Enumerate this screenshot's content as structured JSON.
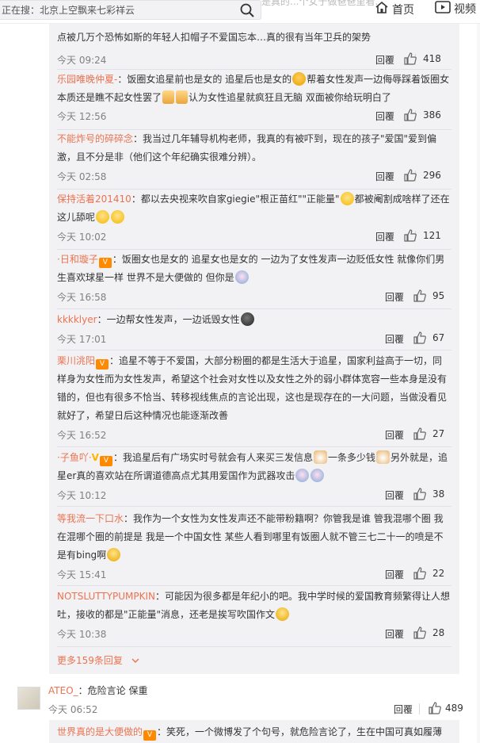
{
  "topbar": {
    "search_text": "正在搜：北京上空飘来七彩祥云",
    "ghost_text": "是真的...个女于做爸爸里看...",
    "home_label": "首页",
    "video_label": "视频"
  },
  "replies": [
    {
      "username": "",
      "text": "点被几万个恐怖如斯的年轻人扣帽子不爱国忘本…真的很有当年卫兵的架势",
      "time": "今天 09:24",
      "reply_label": "回覆",
      "likes": "418"
    },
    {
      "username": "乐园唯晚仲夏-",
      "text": "：饭圈女追星前也是女的 追星后也是女的",
      "text2": "帮着女性发声一边侮辱踩着饭圈女本质还是瞧不起女性罢了",
      "text3": "认为女性追星就疯狂且无脑 双面被你给玩明白了",
      "time": "今天 12:56",
      "reply_label": "回覆",
      "likes": "386"
    },
    {
      "username": "不能炸号的碎碎念",
      "text": "：我当过几年辅导机构老师，我真的有被吓到，现在的孩子\"爱国\"爱到偏激，且不分是非（他们这个年纪确实很难分辨）。",
      "time": "今天 02:58",
      "reply_label": "回覆",
      "likes": "296"
    },
    {
      "username": "保持活着201410",
      "text": "：都以去央视来吹自家giegie\"根正苗红\"\"正能量\"",
      "text2": "都被阉割成啥样了还在这儿舔呢",
      "time": "今天 10:02",
      "reply_label": "回覆",
      "likes": "121"
    },
    {
      "username": "·日和璇子",
      "text": "：饭圈女也是女的 追星女也是女的 一边为了女性发声一边贬低女性 就像你们男生喜欢球星一样 世界不是大便做的 但你是",
      "time": "今天 16:58",
      "reply_label": "回覆",
      "likes": "95"
    },
    {
      "username": "kkkklyer",
      "text": "：一边帮女性发声，一边诋毁女性",
      "time": "今天 17:01",
      "reply_label": "回覆",
      "likes": "67"
    },
    {
      "username": "栗川洮阳",
      "text": "：追星不等于不爱国，大部分粉圈的都是生活大于追星，国家利益高于一切，同样身为女性而为女性发声，希望这个社会对女性以及女性之外的弱小群体宽容一些本身是没有错的，但也有很多不恰当、转移视线焦点的言论出现，这也是现存在的一大问题，当做没看见就好了，希望日后这种情况也能逐渐改善",
      "time": "今天 16:52",
      "reply_label": "回覆",
      "likes": "27"
    },
    {
      "username": "·子鱼吖·",
      "text": "：我追星后有广场实时号就会有人来买三发信息",
      "text2": "一条多少钱",
      "text3": "另外就是，追星er真的喜欢站在所谓道德高点尤其用爱国作为武器攻击",
      "time": "今天 10:12",
      "reply_label": "回覆",
      "likes": "38"
    },
    {
      "username": "等我流一下口水",
      "text": "：我作为一个女性为女性发声还不能带粉籍啊？你管我是谁 管我混哪个圈 我在混哪个圈的前提是 我是一个中国女性 某些人看到哪里有饭圈人就不管三七二十一的喷是不是有bing啊",
      "time": "今天 15:41",
      "reply_label": "回覆",
      "likes": "22"
    },
    {
      "username": "NOTSLUTTYPUMPKIN",
      "text": "：可能因为很多都是年纪小的吧。我中学时候的爱国教育频繁得让人想吐，接收的都是\"正能量\"消息，还老是挨写吹国作文",
      "time": "今天 10:38",
      "reply_label": "回覆",
      "likes": "28"
    }
  ],
  "more_replies": "更多159条回复",
  "main_comment": {
    "username": "ATEO_",
    "text": "：危险言论 保重",
    "time": "今天 06:52",
    "reply_label": "回覆",
    "likes": "489"
  },
  "next_comment": {
    "username": "世界真的是大便做的",
    "text": "：笑死，一个微博发了个句号，就危险言论了，生在中国可真如履薄"
  },
  "colors": {
    "username": "#eb7350",
    "panel_bg": "#f2f2f5",
    "meta_gray": "#808080"
  },
  "icons": {
    "search": "search-icon",
    "home": "home-icon",
    "video": "video-icon",
    "like": "thumbs-up-icon",
    "more": "chevron-down-icon"
  }
}
